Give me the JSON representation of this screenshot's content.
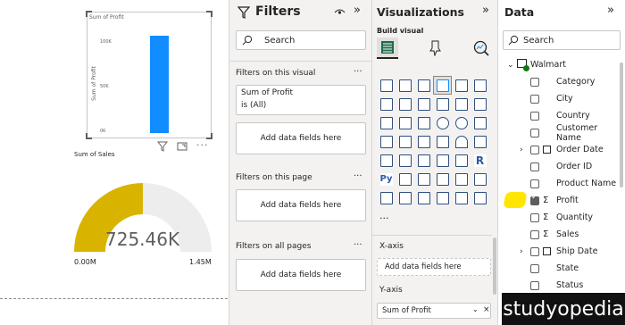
{
  "canvas": {
    "bar_chart": {
      "title": "Sum of Profit",
      "ylabel": "Sum of Profit",
      "ticks": [
        "100K",
        "50K",
        "0K"
      ]
    },
    "gauge": {
      "title": "Sum of Sales",
      "value_label": "725.46K",
      "min_label": "0.00M",
      "max_label": "1.45M",
      "fill_fraction": 0.5,
      "fill_color": "#d8b400",
      "track_color": "#ededed"
    }
  },
  "filters": {
    "title": "Filters",
    "search_placeholder": "Search",
    "on_visual": "Filters on this visual",
    "filter_card_line1": "Sum of Profit",
    "filter_card_line2": "is (All)",
    "add_fields": "Add data fields here",
    "on_page": "Filters on this page",
    "on_all_pages": "Filters on all pages",
    "more": "···"
  },
  "visualizations": {
    "title": "Visualizations",
    "build_visual": "Build visual",
    "more": "···",
    "xaxis_label": "X-axis",
    "xaxis_add": "Add data fields here",
    "yaxis_label": "Y-axis",
    "yaxis_value": "Sum of Profit"
  },
  "data_pane": {
    "title": "Data",
    "search_placeholder": "Search",
    "table": "Walmart",
    "fields": [
      {
        "label": "Category",
        "sigma": false,
        "expand": false,
        "checked": false
      },
      {
        "label": "City",
        "sigma": false,
        "expand": false,
        "checked": false
      },
      {
        "label": "Country",
        "sigma": false,
        "expand": false,
        "checked": false
      },
      {
        "label": "Customer Name",
        "sigma": false,
        "expand": false,
        "checked": false
      },
      {
        "label": "Order Date",
        "sigma": false,
        "expand": true,
        "checked": false
      },
      {
        "label": "Order ID",
        "sigma": false,
        "expand": false,
        "checked": false
      },
      {
        "label": "Product Name",
        "sigma": false,
        "expand": false,
        "checked": false
      },
      {
        "label": "Profit",
        "sigma": true,
        "expand": false,
        "checked": true
      },
      {
        "label": "Quantity",
        "sigma": true,
        "expand": false,
        "checked": false
      },
      {
        "label": "Sales",
        "sigma": true,
        "expand": false,
        "checked": false
      },
      {
        "label": "Ship Date",
        "sigma": false,
        "expand": true,
        "checked": false
      },
      {
        "label": "State",
        "sigma": false,
        "expand": false,
        "checked": false
      },
      {
        "label": "Status",
        "sigma": false,
        "expand": false,
        "checked": false
      }
    ]
  },
  "watermark": "studyopedia"
}
